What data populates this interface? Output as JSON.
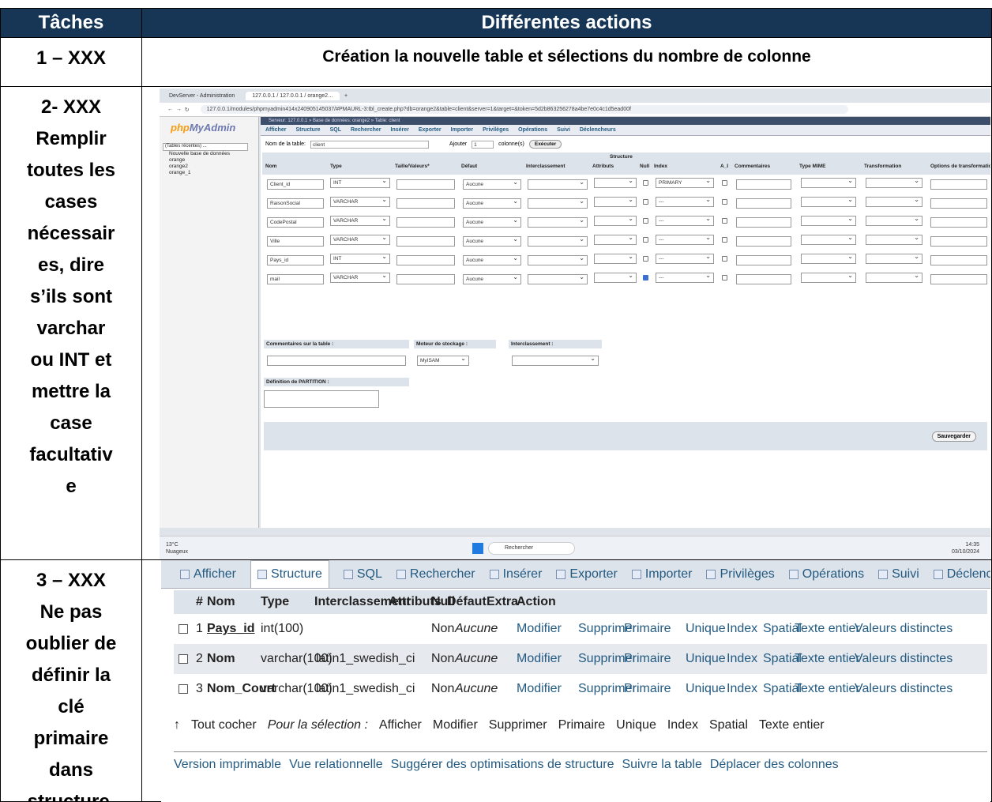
{
  "headers": {
    "taches": "Tâches",
    "actions": "Différentes actions"
  },
  "row1": {
    "task": "1 – XXX",
    "desc": "Création la nouvelle table et sélections du nombre de colonne"
  },
  "row2": {
    "task_lines": [
      "2- XXX",
      "Remplir",
      "toutes les",
      "cases",
      "nécessair",
      "es, dire",
      "s’ils sont",
      "varchar",
      "ou INT et",
      "mettre la",
      "case",
      "facultativ",
      "e"
    ]
  },
  "row3": {
    "task_lines": [
      "3 – XXX",
      "Ne pas",
      "oublier de",
      "définir la",
      "clé",
      "primaire",
      "dans",
      "structure."
    ]
  },
  "browser": {
    "tabs": [
      "DevServer - Administration",
      "127.0.0.1 / 127.0.0.1 / orange2…"
    ],
    "url": "127.0.0.1/modules/phpmyadmin414x240905145037/#PMAURL-3:tbl_create.php?db=orange2&table=client&server=1&target=&token=5d2b863256278a4be7e0c4c1d5ead00f"
  },
  "pma": {
    "logo_a": "php",
    "logo_b": "MyAdmin",
    "recent": "(Tables récentes) ...",
    "tree": [
      "Nouvelle base de données",
      "orange",
      "orange2",
      "orange_1"
    ],
    "breadcrumb": "Serveur: 127.0.0.1 » Base de données: orange2 » Table: client",
    "menu": [
      "Afficher",
      "Structure",
      "SQL",
      "Rechercher",
      "Insérer",
      "Exporter",
      "Importer",
      "Privilèges",
      "Opérations",
      "Suivi",
      "Déclencheurs"
    ],
    "table_name_label": "Nom de la table:",
    "table_name": "client",
    "add_label": "Ajouter",
    "add_value": "1",
    "columns_label": "colonne(s)",
    "execute": "Exécuter",
    "structure_label": "Structure",
    "col_headers": [
      "Nom",
      "Type",
      "Taille/Valeurs*",
      "Défaut",
      "Interclassement",
      "Attributs",
      "Null",
      "Index",
      "A_I",
      "Commentaires",
      "Type MIME",
      "Transformation",
      "Options de transformation"
    ],
    "columns": [
      {
        "name": "Client_id",
        "type": "INT",
        "default": "Aucune",
        "index": "PRIMARY",
        "null": false
      },
      {
        "name": "RaisonSocial",
        "type": "VARCHAR",
        "default": "Aucune",
        "index": "---",
        "null": false
      },
      {
        "name": "CodePostal",
        "type": "VARCHAR",
        "default": "Aucune",
        "index": "---",
        "null": false
      },
      {
        "name": "Ville",
        "type": "VARCHAR",
        "default": "Aucune",
        "index": "---",
        "null": false
      },
      {
        "name": "Pays_id",
        "type": "INT",
        "default": "Aucune",
        "index": "---",
        "null": false
      },
      {
        "name": "mail",
        "type": "VARCHAR",
        "default": "Aucune",
        "index": "---",
        "null": true
      }
    ],
    "table_comments_label": "Commentaires sur la table :",
    "engine_label": "Moteur de stockage :",
    "engine": "MyISAM",
    "collation_label": "Interclassement :",
    "partition_label": "Définition de PARTITION :",
    "save": "Sauvegarder"
  },
  "taskbar": {
    "weather_temp": "13°C",
    "weather": "Nuageux",
    "search": "Rechercher",
    "time": "14:35",
    "date": "03/10/2024"
  },
  "struct2": {
    "tabs": [
      "Afficher",
      "Structure",
      "SQL",
      "Rechercher",
      "Insérer",
      "Exporter",
      "Importer",
      "Privilèges",
      "Opérations",
      "Suivi",
      "Déclencheurs"
    ],
    "headers": [
      "#",
      "Nom",
      "Type",
      "Interclassement",
      "Attributs",
      "Null",
      "Défaut",
      "Extra",
      "Action"
    ],
    "rows": [
      {
        "num": "1",
        "name": "Pays_id",
        "type": "int(100)",
        "coll": "",
        "null": "Non",
        "default": "Aucune"
      },
      {
        "num": "2",
        "name": "Nom",
        "type": "varchar(100)",
        "coll": "latin1_swedish_ci",
        "null": "Non",
        "default": "Aucune"
      },
      {
        "num": "3",
        "name": "Nom_Court",
        "type": "varchar(100)",
        "coll": "latin1_swedish_ci",
        "null": "Non",
        "default": "Aucune"
      }
    ],
    "actions": [
      "Modifier",
      "Supprimer",
      "Primaire",
      "Unique",
      "Index",
      "Spatial",
      "Texte entier",
      "Valeurs distinctes"
    ],
    "check_all": "Tout cocher",
    "for_selection": "Pour la sélection :",
    "bulk": [
      "Afficher",
      "Modifier",
      "Supprimer",
      "Primaire",
      "Unique",
      "Index",
      "Spatial",
      "Texte entier"
    ],
    "links": [
      "Version imprimable",
      "Vue relationnelle",
      "Suggérer des optimisations de structure",
      "Suivre la table",
      "Déplacer des colonnes"
    ]
  }
}
